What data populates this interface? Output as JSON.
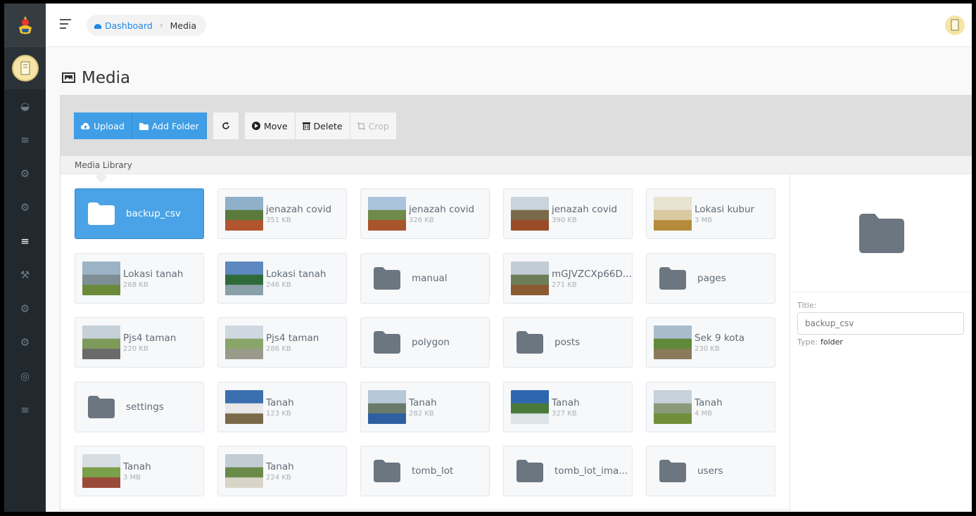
{
  "breadcrumb": {
    "home": "Dashboard",
    "current": "Media"
  },
  "page": {
    "title": "Media"
  },
  "toolbar": {
    "upload": "Upload",
    "add_folder": "Add Folder",
    "move": "Move",
    "delete": "Delete",
    "crop": "Crop"
  },
  "library": {
    "label": "Media Library"
  },
  "items": [
    {
      "name": "backup_csv",
      "size": "",
      "kind": "folder",
      "selected": true
    },
    {
      "name": "jenazah covid",
      "size": "351 KB",
      "kind": "image",
      "thumb": [
        "#8fb0c8",
        "#5c7a3c",
        "#b0552e"
      ]
    },
    {
      "name": "jenazah covid",
      "size": "326 KB",
      "kind": "image",
      "thumb": [
        "#a9c4dc",
        "#6f8a4a",
        "#a8542c"
      ]
    },
    {
      "name": "jenazah covid",
      "size": "390 KB",
      "kind": "image",
      "thumb": [
        "#c9d4dc",
        "#7a6a4a",
        "#9a4c28"
      ]
    },
    {
      "name": "Lokasi kubur",
      "size": "3 MB",
      "kind": "image",
      "thumb": [
        "#e9e3d2",
        "#d8c9a0",
        "#b58a3a"
      ]
    },
    {
      "name": "Lokasi tanah",
      "size": "268 KB",
      "kind": "image",
      "thumb": [
        "#9bb3c4",
        "#7d8f95",
        "#6a8a3a"
      ]
    },
    {
      "name": "Lokasi tanah",
      "size": "246 KB",
      "kind": "image",
      "thumb": [
        "#5d88c0",
        "#2f6b3a",
        "#8aa0a8"
      ]
    },
    {
      "name": "manual",
      "size": "",
      "kind": "folder"
    },
    {
      "name": "mGJVZCXp66D...",
      "size": "271 KB",
      "kind": "image",
      "thumb": [
        "#c2ccd4",
        "#6f7c5a",
        "#8a5a30"
      ]
    },
    {
      "name": "pages",
      "size": "",
      "kind": "folder"
    },
    {
      "name": "Pjs4 taman",
      "size": "220 KB",
      "kind": "image",
      "thumb": [
        "#c5d0d8",
        "#7e9a5a",
        "#6a6a6a"
      ]
    },
    {
      "name": "Pjs4 taman",
      "size": "286 KB",
      "kind": "image",
      "thumb": [
        "#cfd8e0",
        "#8aa56a",
        "#9a9a8a"
      ]
    },
    {
      "name": "polygon",
      "size": "",
      "kind": "folder"
    },
    {
      "name": "posts",
      "size": "",
      "kind": "folder"
    },
    {
      "name": "Sek 9 kota",
      "size": "230 KB",
      "kind": "image",
      "thumb": [
        "#a8bccb",
        "#5f8a3a",
        "#8a7a5a"
      ]
    },
    {
      "name": "settings",
      "size": "",
      "kind": "folder"
    },
    {
      "name": "Tanah",
      "size": "123 KB",
      "kind": "image",
      "thumb": [
        "#3a6fb0",
        "#e8e8e8",
        "#7a6a4a"
      ]
    },
    {
      "name": "Tanah",
      "size": "282 KB",
      "kind": "image",
      "thumb": [
        "#b7c8d8",
        "#6a7a6a",
        "#2f5fa0"
      ]
    },
    {
      "name": "Tanah",
      "size": "327 KB",
      "kind": "image",
      "thumb": [
        "#2f66b0",
        "#4a7a3a",
        "#dce4ea"
      ]
    },
    {
      "name": "Tanah",
      "size": "4 MB",
      "kind": "image",
      "thumb": [
        "#c8d2da",
        "#8a9a7a",
        "#6f8f3a"
      ]
    },
    {
      "name": "Tanah",
      "size": "3 MB",
      "kind": "image",
      "thumb": [
        "#d6dde2",
        "#7aa04a",
        "#9a4a3a"
      ]
    },
    {
      "name": "Tanah",
      "size": "224 KB",
      "kind": "image",
      "thumb": [
        "#c2ccd2",
        "#6a8a4a",
        "#d8d4c8"
      ]
    },
    {
      "name": "tomb_lot",
      "size": "",
      "kind": "folder"
    },
    {
      "name": "tomb_lot_ima...",
      "size": "",
      "kind": "folder"
    },
    {
      "name": "users",
      "size": "",
      "kind": "folder"
    }
  ],
  "details": {
    "title_label": "Title:",
    "title_value": "backup_csv",
    "type_label": "Type:",
    "type_value": "folder"
  },
  "sidebar": {
    "icons": [
      "dashboard-icon",
      "list-icon",
      "gear-icon",
      "gear-icon",
      "list-icon",
      "tools-icon",
      "gear-icon",
      "gear-icon",
      "globe-icon",
      "list-icon"
    ],
    "active_index": 4
  },
  "colors": {
    "accent": "#3f9ee6",
    "sidebar": "#22292e",
    "folder": "#6b7680"
  }
}
